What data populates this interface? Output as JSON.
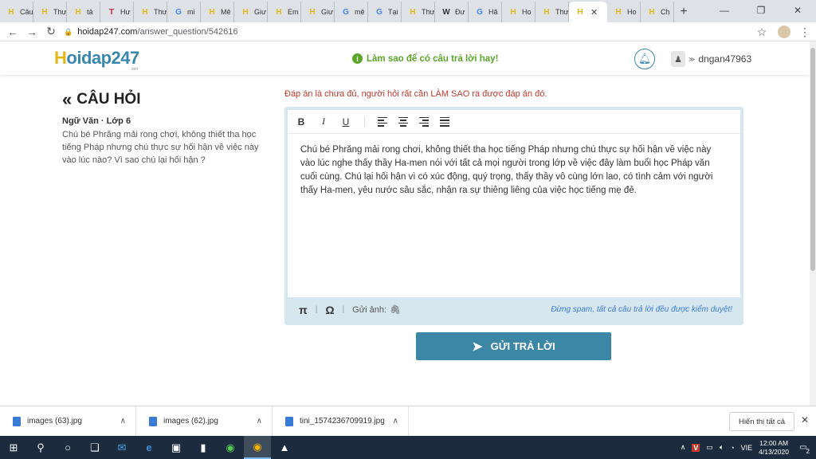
{
  "tabs": [
    {
      "icon": "H",
      "label": "Câu",
      "color": "#e5b714"
    },
    {
      "icon": "H",
      "label": "Thư",
      "color": "#e5b714"
    },
    {
      "icon": "H",
      "label": "tả",
      "color": "#e5b714"
    },
    {
      "icon": "T",
      "label": "Hư",
      "color": "#d0253c"
    },
    {
      "icon": "H",
      "label": "Thư",
      "color": "#e5b714"
    },
    {
      "icon": "G",
      "label": "mi",
      "color": "#4285f4"
    },
    {
      "icon": "H",
      "label": "Mê",
      "color": "#e5b714"
    },
    {
      "icon": "H",
      "label": "Giư",
      "color": "#e5b714"
    },
    {
      "icon": "H",
      "label": "Em",
      "color": "#e5b714"
    },
    {
      "icon": "H",
      "label": "Giư",
      "color": "#e5b714"
    },
    {
      "icon": "G",
      "label": "mê",
      "color": "#4285f4"
    },
    {
      "icon": "G",
      "label": "Tại",
      "color": "#4285f4"
    },
    {
      "icon": "H",
      "label": "Thư",
      "color": "#e5b714"
    },
    {
      "icon": "W",
      "label": "Đư",
      "color": "#333333"
    },
    {
      "icon": "G",
      "label": "Hã",
      "color": "#4285f4"
    },
    {
      "icon": "H",
      "label": "Ho",
      "color": "#e5b714"
    },
    {
      "icon": "H",
      "label": "Thư",
      "color": "#e5b714"
    }
  ],
  "active_tab": {
    "icon": "H",
    "close": "✕"
  },
  "tabs_after": [
    {
      "icon": "H",
      "label": "Ho",
      "color": "#e5b714"
    },
    {
      "icon": "H",
      "label": "Ch",
      "color": "#e5b714"
    }
  ],
  "toolbar": {
    "url_host": "hoidap247.com",
    "url_path": "/answer_question/542616"
  },
  "site": {
    "logo_main": "oidap247",
    "logo_h": "H",
    "logo_com": ".com",
    "tip": "Làm sao để có câu trả lời hay!",
    "username": "dngan47963"
  },
  "question": {
    "heading": "CÂU HỎI",
    "subject": "Ngữ Văn · Lớp 6",
    "text": "Chú bé Phrăng mải rong chơi, không thiết  tha học tiếng Pháp nhưng chú thực sự hối hận về việc này vào lúc nào? Vì sao chú lại hối hận ?"
  },
  "answer": {
    "warning": "Đáp án là chưa đủ, người hỏi rất cần LÀM SAO ra được đáp án đó.",
    "body": " Chú bé Phrăng mải rong chơi, không thiết tha học tiếng Pháp nhưng chú thực sự hối hận về việc này vào lúc nghe thấy thầy Ha-men nói với tất cả mọi người trong lớp về việc đây làm buổi học Pháp văn cuối cùng. Chú lại hối hận vì có xúc động, quý trọng, thấy thầy vô cùng lớn lao, có tình cảm với người thấy Ha-men, yêu nước sâu sắc, nhận ra sự thiêng liêng của việc học tiếng mẹ đẻ.",
    "bold": "B",
    "italic": "I",
    "underline": "U",
    "pi": "π",
    "omega": "Ω",
    "attach_label": "Gửi ảnh:",
    "spam_note": "Đừng spam, tất cả câu trả lời đều được kiểm duyệt!",
    "submit": "GỬI TRẢ LỜI"
  },
  "downloads": [
    {
      "name": "images (63).jpg"
    },
    {
      "name": "images (62).jpg"
    },
    {
      "name": "tini_1574236709919.jpg"
    }
  ],
  "download_show_all": "Hiển thị tất cả",
  "taskbar": {
    "lang": "VIE",
    "time": "12:00 AM",
    "date": "4/13/2020",
    "notif_count": "2"
  }
}
